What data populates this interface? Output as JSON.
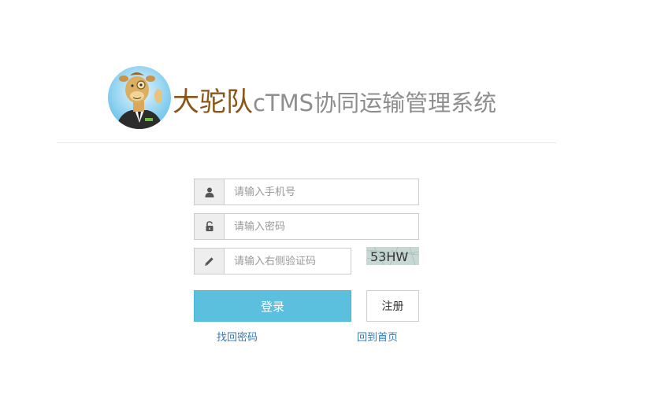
{
  "brand": {
    "main": "大驼队",
    "sub": "cTMS协同运输管理系统"
  },
  "form": {
    "phone": {
      "placeholder": "请输入手机号",
      "value": ""
    },
    "password": {
      "placeholder": "请输入密码",
      "value": ""
    },
    "captcha_input": {
      "placeholder": "请输入右侧验证码",
      "value": ""
    },
    "captcha_text": "53HW"
  },
  "buttons": {
    "login": "登录",
    "register": "注册"
  },
  "links": {
    "forgot": "找回密码",
    "home": "回到首页"
  },
  "icons": {
    "phone": "user-icon",
    "password": "unlock-icon",
    "captcha": "pencil-icon"
  },
  "colors": {
    "brand_main": "#8a5618",
    "brand_sub": "#8e8e8e",
    "login_button": "#5bc0de",
    "link": "#337ab7"
  }
}
